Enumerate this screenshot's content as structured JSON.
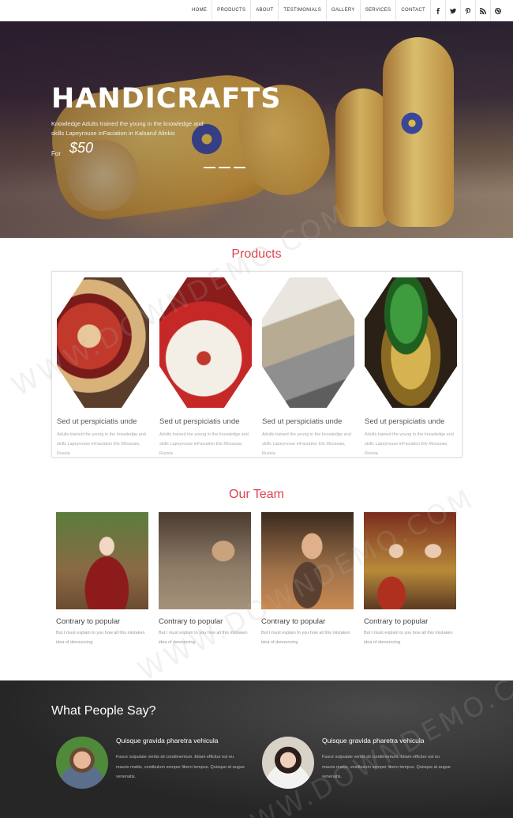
{
  "nav": {
    "items": [
      "HOME",
      "PRODUCTS",
      "ABOUT",
      "TESTIMONIALS",
      "GALLERY",
      "SERVICES",
      "CONTACT"
    ],
    "social_icons": [
      "facebook-icon",
      "twitter-icon",
      "pinterest-icon",
      "rss-icon",
      "dribbble-icon"
    ]
  },
  "hero": {
    "title": "HANDICRAFTS",
    "subtitle": "Knowledge Adults trained the young in the knowledge and skills Lapeyrouse inFaciation in Kalsaruf Alinkis",
    "price_prefix": "For",
    "price": "$50"
  },
  "products": {
    "heading": "Products",
    "items": [
      {
        "title": "Sed ut perspiciatis unde",
        "desc": "Adults trained the young in the knowledge and skills Lapeyrouse inFaciation Ele Mosssaw, Russia"
      },
      {
        "title": "Sed ut perspiciatis unde",
        "desc": "Adults trained the young in the knowledge and skills Lapeyrouse inFaciation Ele Mosssaw, Russia"
      },
      {
        "title": "Sed ut perspiciatis unde",
        "desc": "Adults trained the young in the knowledge and skills Lapeyrouse inFaciation Ele Mosssaw, Russia"
      },
      {
        "title": "Sed ut perspiciatis unde",
        "desc": "Adults trained the young in the knowledge and skills Lapeyrouse inFaciation Ele Mosssaw, Russia"
      }
    ]
  },
  "team": {
    "heading": "Our Team",
    "members": [
      {
        "title": "Contrary to popular",
        "desc": "But I must explain to you how all this mistaken idea of denouncing"
      },
      {
        "title": "Contrary to popular",
        "desc": "But I must explain to you how all this mistaken idea of denouncing"
      },
      {
        "title": "Contrary to popular",
        "desc": "But I must explain to you how all this mistaken idea of denouncing"
      },
      {
        "title": "Contrary to popular",
        "desc": "But I must explain to you how all this mistaken idea of denouncing"
      }
    ]
  },
  "testimonials": {
    "heading": "What People Say?",
    "items": [
      {
        "name": "Quisque gravida pharetra vehicula",
        "text": "Fusce vulputate veritis sit condimentum. Etiam efficitur est eu mauris mattis, vestibulum semper libero tempus. Quisque at augue venenatis."
      },
      {
        "name": "Quisque gravida pharetra vehicula",
        "text": "Fusce vulputate veritis sit condimentum. Etiam efficitur est eu mauris mattis, vestibulum semper libero tempus. Quisque at augue venenatis."
      }
    ]
  },
  "watermark": "WWW.DOWNDEMO.COM",
  "colors": {
    "accent": "#e0424f",
    "dark_section": "#262626"
  }
}
